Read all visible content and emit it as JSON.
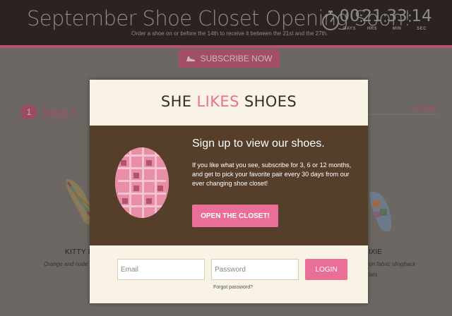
{
  "header": {
    "title": "September Shoe Closet Opening Soon!",
    "subtitle": "Order a shoe on or before the 14th to receive it between the 21st and the 27th.",
    "countdown": [
      {
        "value": "00",
        "label": "DAYS"
      },
      {
        "value": "21",
        "label": "HRS"
      },
      {
        "value": "33",
        "label": "MIN"
      },
      {
        "value": "14",
        "label": "SEC"
      }
    ],
    "separator": ":"
  },
  "page": {
    "subscribe_label": "SUBSCRIBE NOW",
    "step_number": "1",
    "step_label": "Step /",
    "items_count": "5 ITEMS",
    "product_left": {
      "name": "KITTY F",
      "desc": "Orange and nude k"
    },
    "product_right": {
      "name": "IXIE",
      "desc_line1": "on fabric slingback",
      "desc_line2": "lats"
    }
  },
  "modal": {
    "brand_part1": "SHE",
    "brand_part2": "LIKES",
    "brand_part3": "SHOES",
    "heading": "Sign up to view our shoes.",
    "body": "If you like what you see, subscribe for 3, 6 or 12 months, and get to pick your favorite pair every 30 days from our ever changing shoe closet!",
    "cta_label": "OPEN THE CLOSET!",
    "email_placeholder": "Email",
    "password_placeholder": "Password",
    "login_label": "LOGIN",
    "forgot_label": "Forgot password?"
  },
  "colors": {
    "accent": "#ea6f97",
    "dark_panel": "#553f2b",
    "header_bg": "#2b2320",
    "modal_bg": "#f8f3e4"
  },
  "icons": [
    "stopwatch-icon",
    "shoe-icon"
  ]
}
